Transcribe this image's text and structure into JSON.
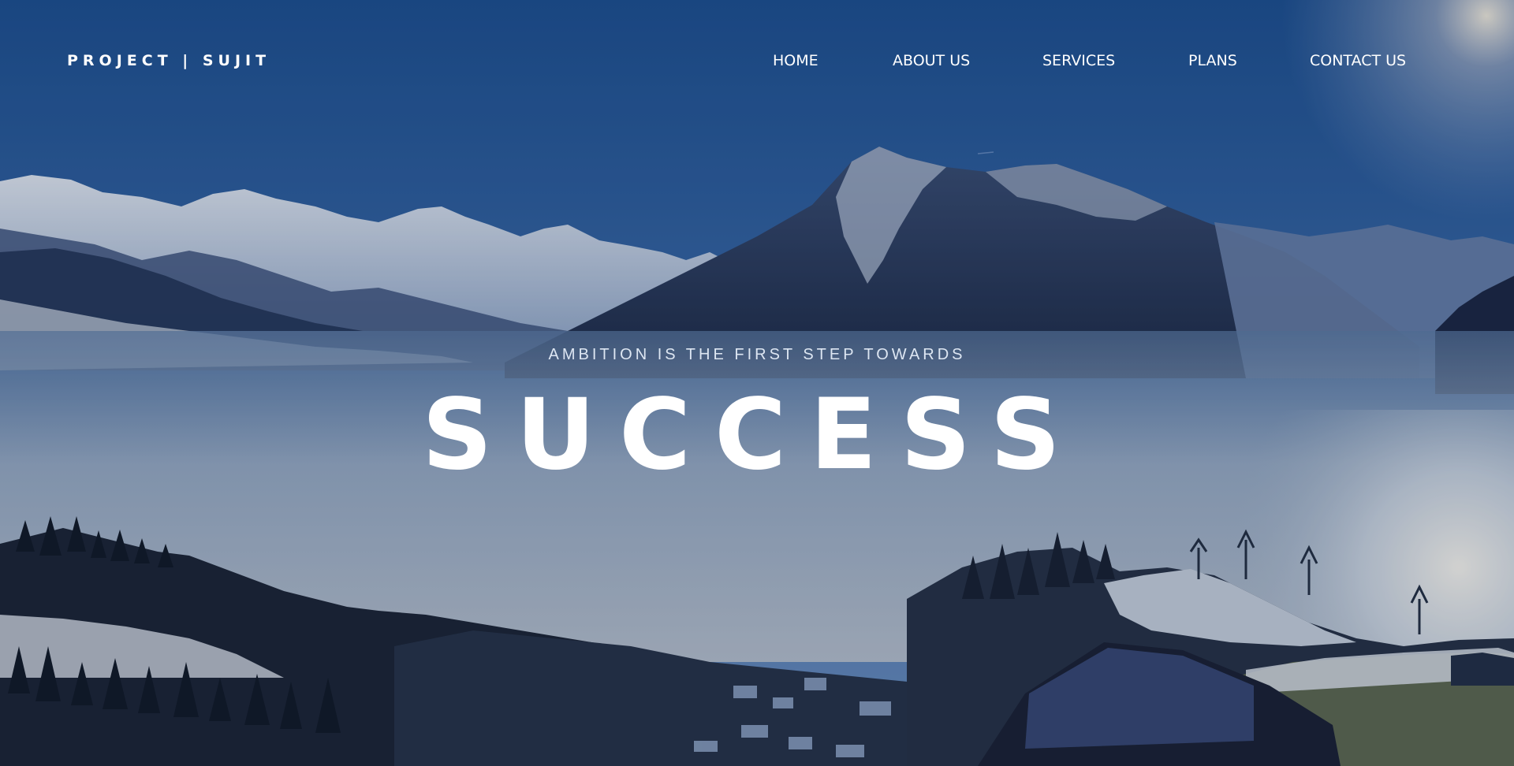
{
  "brand": {
    "logo_text": "PROJECT | SUJIT"
  },
  "nav": {
    "items": [
      {
        "label": "HOME"
      },
      {
        "label": "ABOUT US"
      },
      {
        "label": "SERVICES"
      },
      {
        "label": "PLANS"
      },
      {
        "label": "CONTACT US"
      }
    ]
  },
  "hero": {
    "tagline": "AMBITION IS THE FIRST STEP TOWARDS",
    "headline": "SUCCESS",
    "background": "mountain-valley-photo"
  },
  "colors": {
    "sky_top": "#1e5596",
    "sky_bottom": "#4d7cb8",
    "text": "#ffffff",
    "fog": "#b8c8da"
  }
}
